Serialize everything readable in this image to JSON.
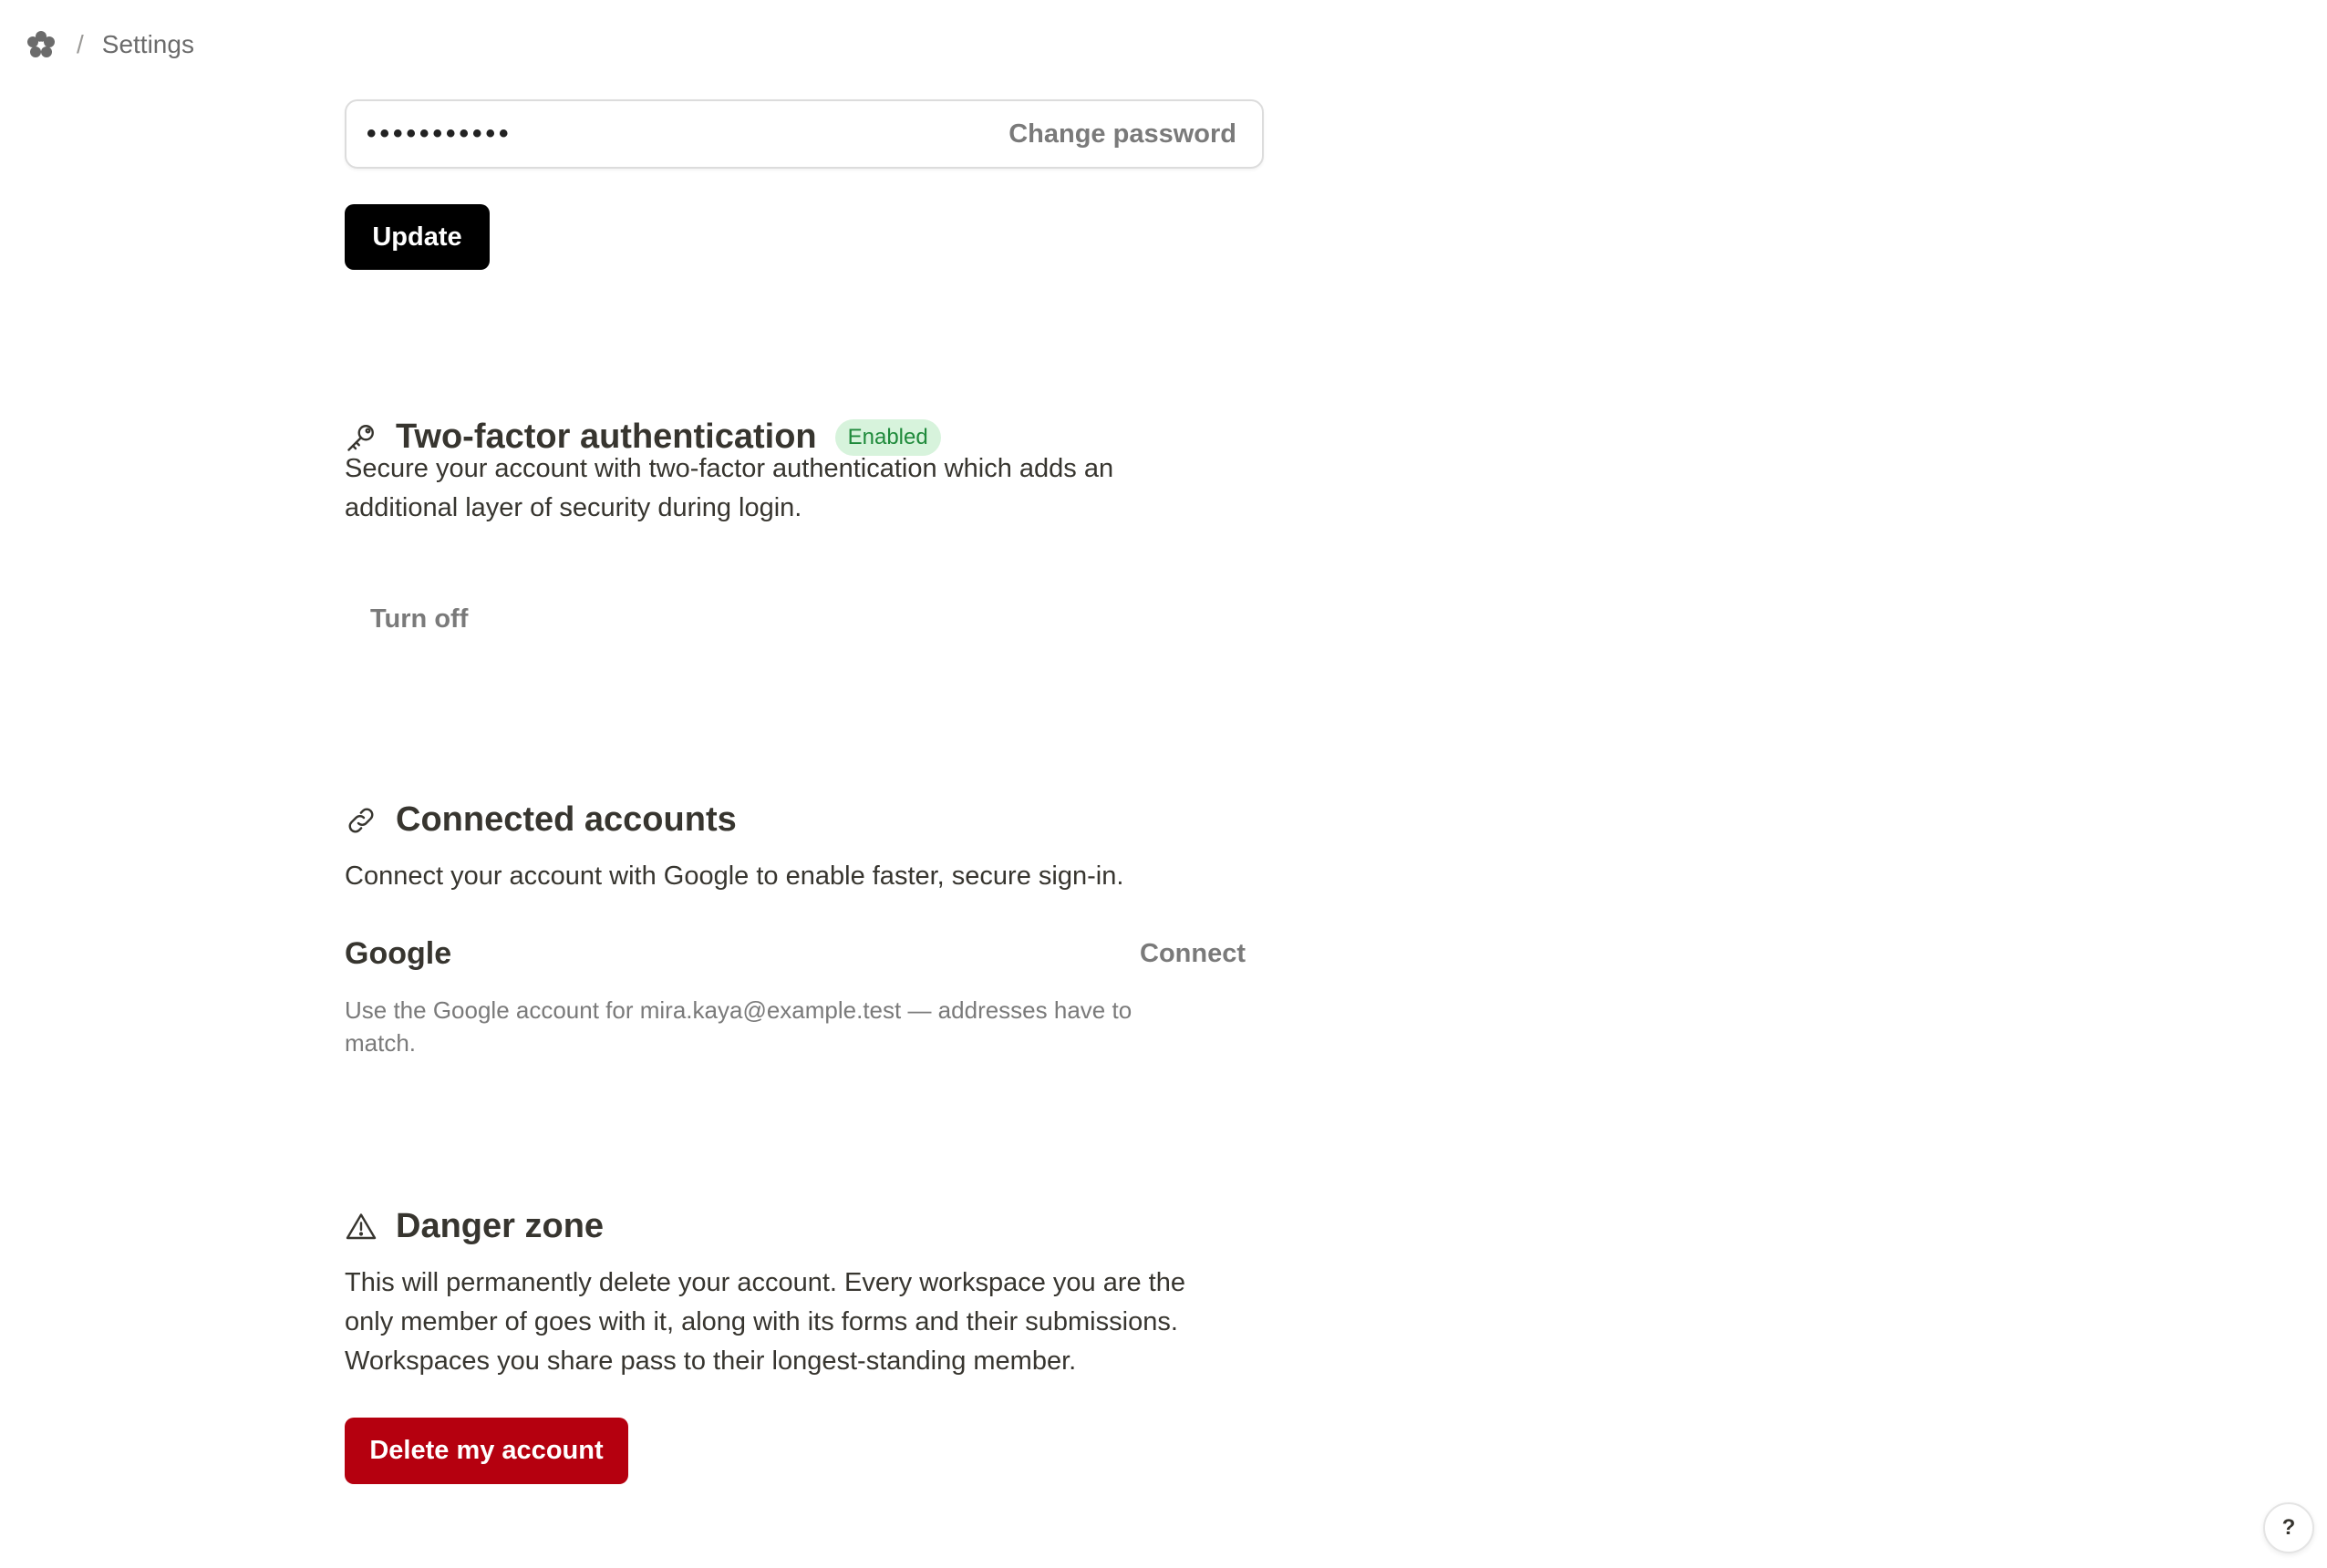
{
  "breadcrumb": {
    "separator": "/",
    "current": "Settings",
    "logo_icon": "flower-logo-icon"
  },
  "password": {
    "masked_value": "•••••••••••",
    "change_label": "Change password",
    "update_label": "Update"
  },
  "two_factor": {
    "icon": "key-icon",
    "title": "Two-factor authentication",
    "status": "Enabled",
    "status_color": "#1f8a3b",
    "description_line1": "Secure your account with two-factor authentication which adds an",
    "description_line2": "additional layer of security during login.",
    "turn_off_label": "Turn off"
  },
  "connected": {
    "icon": "link-icon",
    "title": "Connected accounts",
    "description": "Connect your account with Google to enable faster, secure sign-in.",
    "provider": "Google",
    "connect_label": "Connect",
    "note_line1": "Use the Google account for mira.kaya@example.test — addresses have to",
    "note_line2": "match."
  },
  "danger": {
    "icon": "warning-triangle-icon",
    "title": "Danger zone",
    "line1": "This will permanently delete your account. Every workspace you are the",
    "line2": "only member of goes with it, along with its forms and their submissions.",
    "line3": "Workspaces you share pass to their longest-standing member.",
    "delete_label": "Delete my account",
    "accent": "#b5000f"
  },
  "help": {
    "label": "?"
  }
}
